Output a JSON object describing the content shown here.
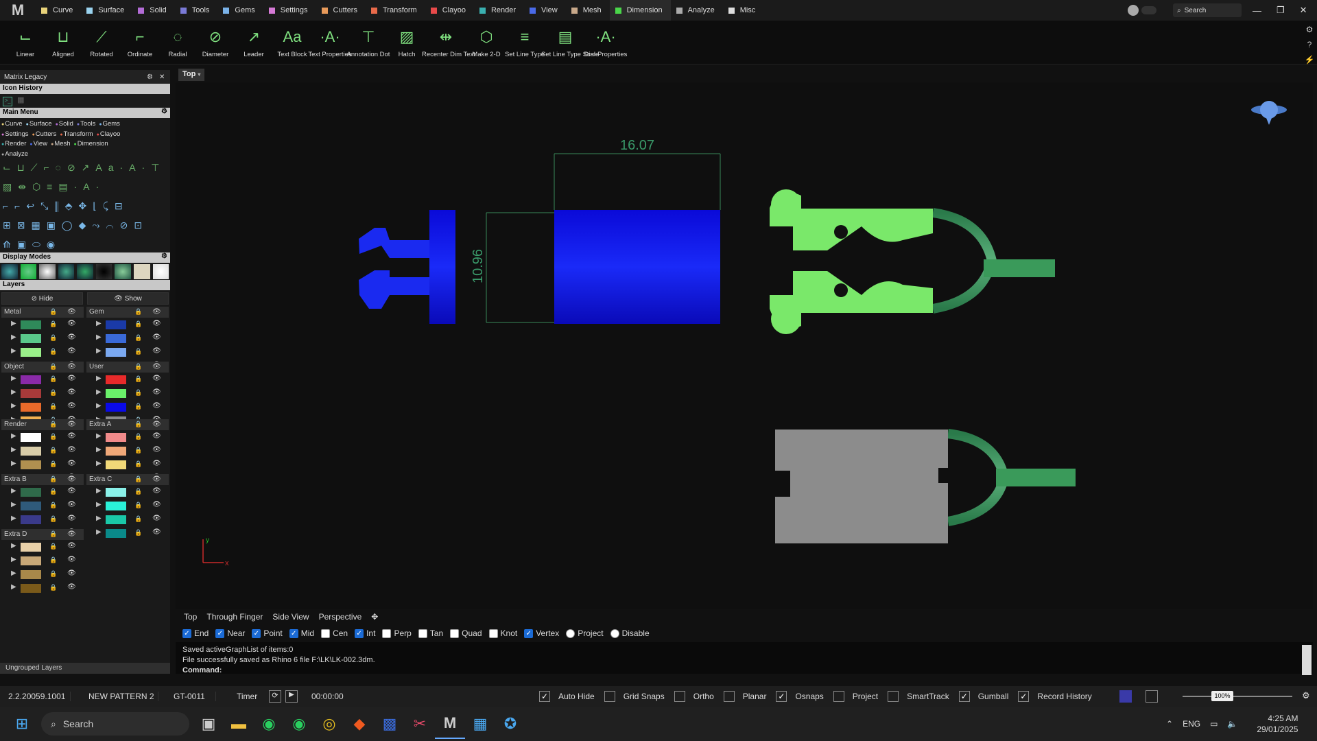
{
  "app": {
    "logo": "M"
  },
  "tabs": [
    {
      "label": "Curve",
      "color": "#e8d27a"
    },
    {
      "label": "Surface",
      "color": "#9ad3ef"
    },
    {
      "label": "Solid",
      "color": "#b36cd6"
    },
    {
      "label": "Tools",
      "color": "#7a7ad6"
    },
    {
      "label": "Gems",
      "color": "#7ab2e8"
    },
    {
      "label": "Settings",
      "color": "#d67ad6"
    },
    {
      "label": "Cutters",
      "color": "#e89a5a"
    },
    {
      "label": "Transform",
      "color": "#e86a4a"
    },
    {
      "label": "Clayoo",
      "color": "#e84a4a"
    },
    {
      "label": "Render",
      "color": "#3ab0b0"
    },
    {
      "label": "View",
      "color": "#4a6ae8"
    },
    {
      "label": "Mesh",
      "color": "#c8a88a"
    },
    {
      "label": "Dimension",
      "color": "#4ad64a"
    },
    {
      "label": "Analyze",
      "color": "#aaaaaa"
    },
    {
      "label": "Misc",
      "color": "#dddddd"
    }
  ],
  "search": {
    "placeholder": "Search"
  },
  "ribbon": [
    {
      "label": "Linear",
      "icon": "linear-dim-icon"
    },
    {
      "label": "Aligned",
      "icon": "aligned-dim-icon"
    },
    {
      "label": "Rotated",
      "icon": "rotated-dim-icon"
    },
    {
      "label": "Ordinate",
      "icon": "ordinate-dim-icon"
    },
    {
      "label": "Radial",
      "icon": "radial-dim-icon"
    },
    {
      "label": "Diameter",
      "icon": "diameter-dim-icon"
    },
    {
      "label": "Leader",
      "icon": "leader-icon"
    },
    {
      "label": "Text Block",
      "icon": "text-block-icon"
    },
    {
      "label": "Text Properties",
      "icon": "text-properties-icon"
    },
    {
      "label": "Annotation Dot",
      "icon": "annotation-dot-icon"
    },
    {
      "label": "Hatch",
      "icon": "hatch-icon"
    },
    {
      "label": "Recenter Dim Text",
      "icon": "recenter-icon"
    },
    {
      "label": "Make 2-D",
      "icon": "make-2d-icon"
    },
    {
      "label": "Set Line Type",
      "icon": "line-type-icon"
    },
    {
      "label": "Set Line Type Scale",
      "icon": "line-scale-icon"
    },
    {
      "label": "Dim Properties",
      "icon": "dim-properties-icon"
    }
  ],
  "sidebar": {
    "title": "Matrix Legacy",
    "icon_history": "Icon History",
    "main_menu": "Main Menu",
    "menu_items": [
      {
        "label": "Curve",
        "color": "#e8d27a"
      },
      {
        "label": "Surface",
        "color": "#9ad3ef"
      },
      {
        "label": "Solid",
        "color": "#b36cd6"
      },
      {
        "label": "Tools",
        "color": "#7a7ad6"
      },
      {
        "label": "Gems",
        "color": "#7ab2e8"
      },
      {
        "label": "Settings",
        "color": "#d67ad6"
      },
      {
        "label": "Cutters",
        "color": "#e89a5a"
      },
      {
        "label": "Transform",
        "color": "#e86a4a"
      },
      {
        "label": "Clayoo",
        "color": "#e84a4a"
      },
      {
        "label": "Render",
        "color": "#3ab0b0"
      },
      {
        "label": "View",
        "color": "#4a6ae8"
      },
      {
        "label": "Mesh",
        "color": "#c8a88a"
      },
      {
        "label": "Dimension",
        "color": "#4ad64a"
      },
      {
        "label": "Analyze",
        "color": "#aaaaaa"
      }
    ],
    "display_modes": "Display Modes",
    "layers": "Layers",
    "hide": "Hide",
    "show": "Show",
    "groups_left": [
      {
        "name": "Metal",
        "colors": [
          "#2f8a5a",
          "#5ac88a",
          "#9af08a",
          "#c8f0b8"
        ]
      },
      {
        "name": "Object",
        "colors": [
          "#8a2aa8",
          "#a83a3a",
          "#e86a2a",
          "#f0b050"
        ]
      },
      {
        "name": "Render",
        "colors": [
          "#ffffff",
          "#d8cca8",
          "#b09050",
          "#8a6a2a"
        ]
      },
      {
        "name": "Extra B",
        "colors": [
          "#2f6a4a",
          "#2f5a7a",
          "#3a3a8a",
          "#6a2a5a"
        ]
      },
      {
        "name": "Extra D",
        "colors": [
          "#e8d0a8",
          "#c8a878",
          "#a8884a",
          "#7a5a1a"
        ]
      }
    ],
    "groups_right": [
      {
        "name": "Gem",
        "colors": [
          "#1a3aa8",
          "#3a6ad8",
          "#7aa8f0",
          "#a8c8f8"
        ]
      },
      {
        "name": "User",
        "colors": [
          "#e82a2a",
          "#6af06a",
          "#0a0ae8",
          "#8a8a8a"
        ]
      },
      {
        "name": "Extra A",
        "colors": [
          "#f08a8a",
          "#f0a878",
          "#f0d878",
          "#d8e86a"
        ]
      },
      {
        "name": "Extra C",
        "colors": [
          "#8af0e8",
          "#2af0d8",
          "#1ac8a8",
          "#0a8a8a"
        ]
      }
    ],
    "ungrouped": "Ungrouped Layers"
  },
  "viewport": {
    "label": "Top",
    "dim_width": "16.07",
    "dim_height": "10.96",
    "axis_x": "x",
    "axis_y": "y"
  },
  "view_tabs": [
    "Top",
    "Through Finger",
    "Side View",
    "Perspective"
  ],
  "osnaps": [
    {
      "label": "End",
      "on": true
    },
    {
      "label": "Near",
      "on": true
    },
    {
      "label": "Point",
      "on": true
    },
    {
      "label": "Mid",
      "on": true
    },
    {
      "label": "Cen",
      "on": false
    },
    {
      "label": "Int",
      "on": true
    },
    {
      "label": "Perp",
      "on": false
    },
    {
      "label": "Tan",
      "on": false
    },
    {
      "label": "Quad",
      "on": false
    },
    {
      "label": "Knot",
      "on": false
    },
    {
      "label": "Vertex",
      "on": true
    },
    {
      "label": "Project",
      "on": false
    },
    {
      "label": "Disable",
      "on": false
    }
  ],
  "command": {
    "line1": "Saved activeGraphList of items:0",
    "line2": "File successfully saved as Rhino 6 file F:\\LK\\LK-002.3dm.",
    "prompt": "Command:"
  },
  "status": {
    "version": "2.2.20059.1001",
    "pattern": "NEW PATTERN 2",
    "code": "GT-0011",
    "timer": "Timer",
    "time": "00:00:00",
    "toggles": [
      {
        "label": "Auto Hide",
        "on": true
      },
      {
        "label": "Grid Snaps",
        "on": false
      },
      {
        "label": "Ortho",
        "on": false
      },
      {
        "label": "Planar",
        "on": false
      },
      {
        "label": "Osnaps",
        "on": true
      },
      {
        "label": "Project",
        "on": false
      },
      {
        "label": "SmartTrack",
        "on": false
      },
      {
        "label": "Gumball",
        "on": true
      },
      {
        "label": "Record History",
        "on": true
      }
    ],
    "zoom": "100%"
  },
  "taskbar": {
    "search": "Search",
    "lang": "ENG",
    "time": "4:25 AM",
    "date": "29/01/2025"
  }
}
